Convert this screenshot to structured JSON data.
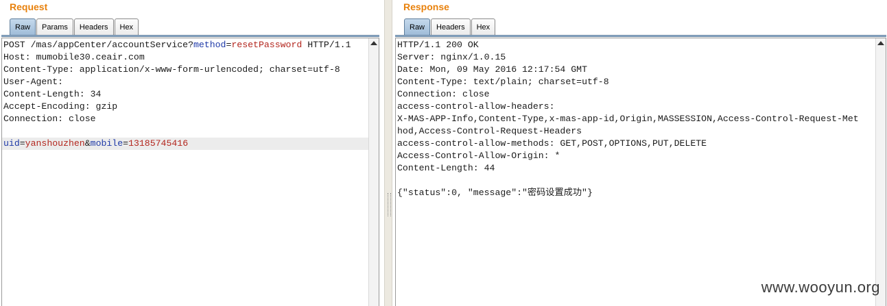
{
  "request": {
    "title": "Request",
    "tabs": [
      "Raw",
      "Params",
      "Headers",
      "Hex"
    ],
    "active_tab": "Raw",
    "lines": [
      [
        {
          "t": "POST /mas/appCenter/accountService?"
        },
        {
          "t": "method",
          "c": "k"
        },
        {
          "t": "="
        },
        {
          "t": "resetPassword",
          "c": "v"
        },
        {
          "t": " HTTP/1.1"
        }
      ],
      [
        {
          "t": "Host: mumobile30.ceair.com"
        }
      ],
      [
        {
          "t": "Content-Type: application/x-www-form-urlencoded; charset=utf-8"
        }
      ],
      [
        {
          "t": "User-Agent:"
        }
      ],
      [
        {
          "t": "Content-Length: 34"
        }
      ],
      [
        {
          "t": "Accept-Encoding: gzip"
        }
      ],
      [
        {
          "t": "Connection: close"
        }
      ],
      [
        {
          "t": ""
        }
      ],
      [
        {
          "t": "uid",
          "c": "k"
        },
        {
          "t": "="
        },
        {
          "t": "yanshouzhen",
          "c": "v"
        },
        {
          "t": "&"
        },
        {
          "t": "mobile",
          "c": "k"
        },
        {
          "t": "="
        },
        {
          "t": "13185745416",
          "c": "v"
        }
      ]
    ],
    "highlight_line": 8
  },
  "response": {
    "title": "Response",
    "tabs": [
      "Raw",
      "Headers",
      "Hex"
    ],
    "active_tab": "Raw",
    "lines": [
      [
        {
          "t": "HTTP/1.1 200 OK"
        }
      ],
      [
        {
          "t": "Server: nginx/1.0.15"
        }
      ],
      [
        {
          "t": "Date: Mon, 09 May 2016 12:17:54 GMT"
        }
      ],
      [
        {
          "t": "Content-Type: text/plain; charset=utf-8"
        }
      ],
      [
        {
          "t": "Connection: close"
        }
      ],
      [
        {
          "t": "access-control-allow-headers:"
        }
      ],
      [
        {
          "t": "X-MAS-APP-Info,Content-Type,x-mas-app-id,Origin,MASSESSION,Access-Control-Request-Met"
        }
      ],
      [
        {
          "t": "hod,Access-Control-Request-Headers"
        }
      ],
      [
        {
          "t": "access-control-allow-methods: GET,POST,OPTIONS,PUT,DELETE"
        }
      ],
      [
        {
          "t": "Access-Control-Allow-Origin: *"
        }
      ],
      [
        {
          "t": "Content-Length: 44"
        }
      ],
      [
        {
          "t": ""
        }
      ],
      [
        {
          "t": "{\"status\":0, \"message\":\"密码设置成功\"}"
        }
      ]
    ],
    "highlight_line": -1
  },
  "watermark": "www.wooyun.org",
  "colors": {
    "accent": "#e8810c",
    "param_name": "#1f3aa8",
    "param_value": "#b3261e"
  }
}
